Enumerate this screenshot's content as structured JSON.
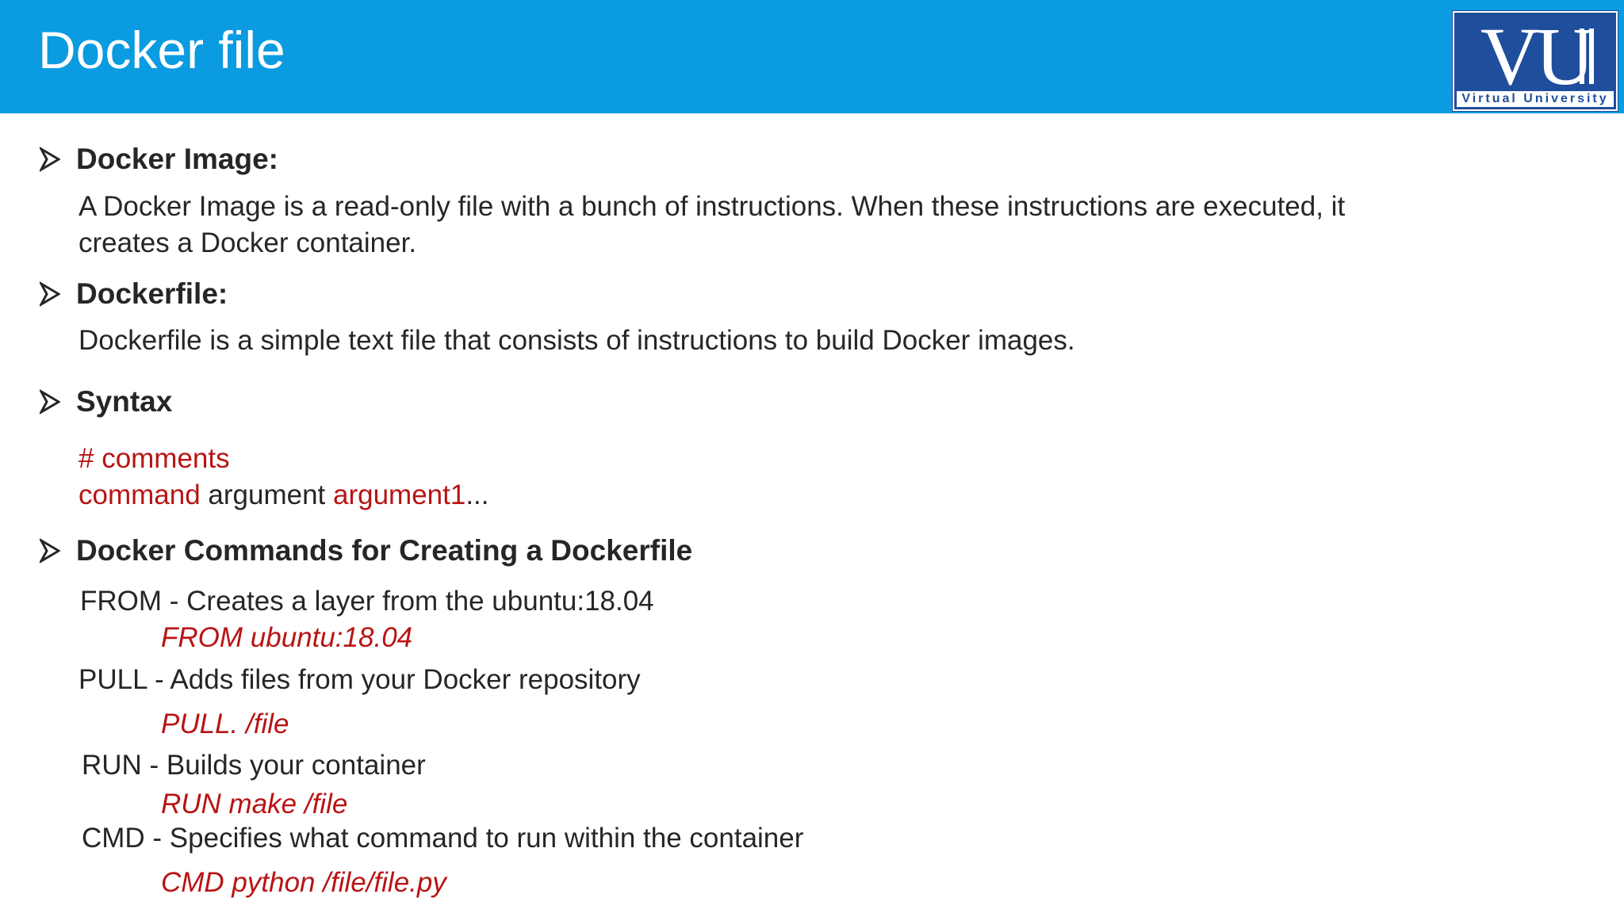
{
  "slide": {
    "title": "Docker file"
  },
  "logo": {
    "monogram": "VU",
    "caption": "Virtual University",
    "color": "#1f4e9c"
  },
  "colors": {
    "header": "#0b9be0",
    "accent_red": "#b81414",
    "text": "#262626"
  },
  "sections": {
    "docker_image": {
      "heading": "Docker Image:",
      "body_line1": "A Docker Image is a read-only file with a bunch of instructions. When these instructions are executed, it",
      "body_line2": "creates a Docker container."
    },
    "dockerfile": {
      "heading": "Dockerfile:",
      "body": "Dockerfile is a simple text file that consists of instructions to build Docker images."
    },
    "syntax": {
      "heading": "Syntax",
      "comment": "# comments",
      "command": "command",
      "argument": " argument ",
      "argument1": "argument1",
      "ellipsis": "..."
    },
    "commands": {
      "heading": "Docker Commands for Creating a Dockerfile",
      "items": [
        {
          "description": "FROM - Creates a layer from the ubuntu:18.04",
          "example": "FROM ubuntu:18.04"
        },
        {
          "description": "PULL - Adds files from your Docker repository",
          "example": "PULL. /file"
        },
        {
          "description": "RUN - Builds your container",
          "example": "RUN make /file"
        },
        {
          "description": "CMD - Specifies what command to run within the container",
          "example": "CMD python /file/file.py"
        }
      ]
    }
  }
}
